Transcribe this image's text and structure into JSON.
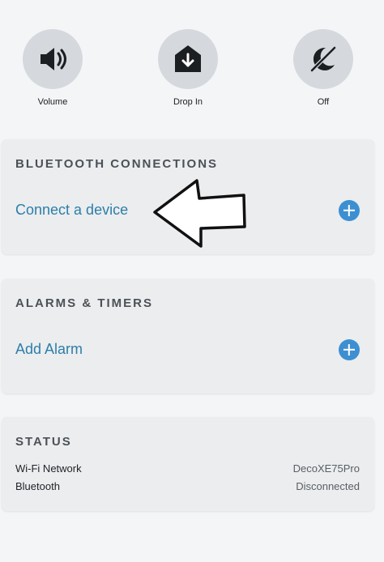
{
  "quick_actions": [
    {
      "label": "Volume",
      "icon": "speaker-icon"
    },
    {
      "label": "Drop In",
      "icon": "drop-in-icon"
    },
    {
      "label": "Off",
      "icon": "do-not-disturb-icon"
    }
  ],
  "bluetooth": {
    "title": "BLUETOOTH CONNECTIONS",
    "action": "Connect a device"
  },
  "alarms": {
    "title": "ALARMS & TIMERS",
    "action": "Add Alarm"
  },
  "status": {
    "title": "STATUS",
    "rows": [
      {
        "label": "Wi-Fi Network",
        "value": "DecoXE75Pro"
      },
      {
        "label": "Bluetooth",
        "value": "Disconnected"
      }
    ]
  },
  "colors": {
    "accent": "#2e7ea8",
    "plus_button": "#3d8fd1",
    "card_bg": "#ebedef",
    "icon_circle": "#d5d8dc"
  }
}
